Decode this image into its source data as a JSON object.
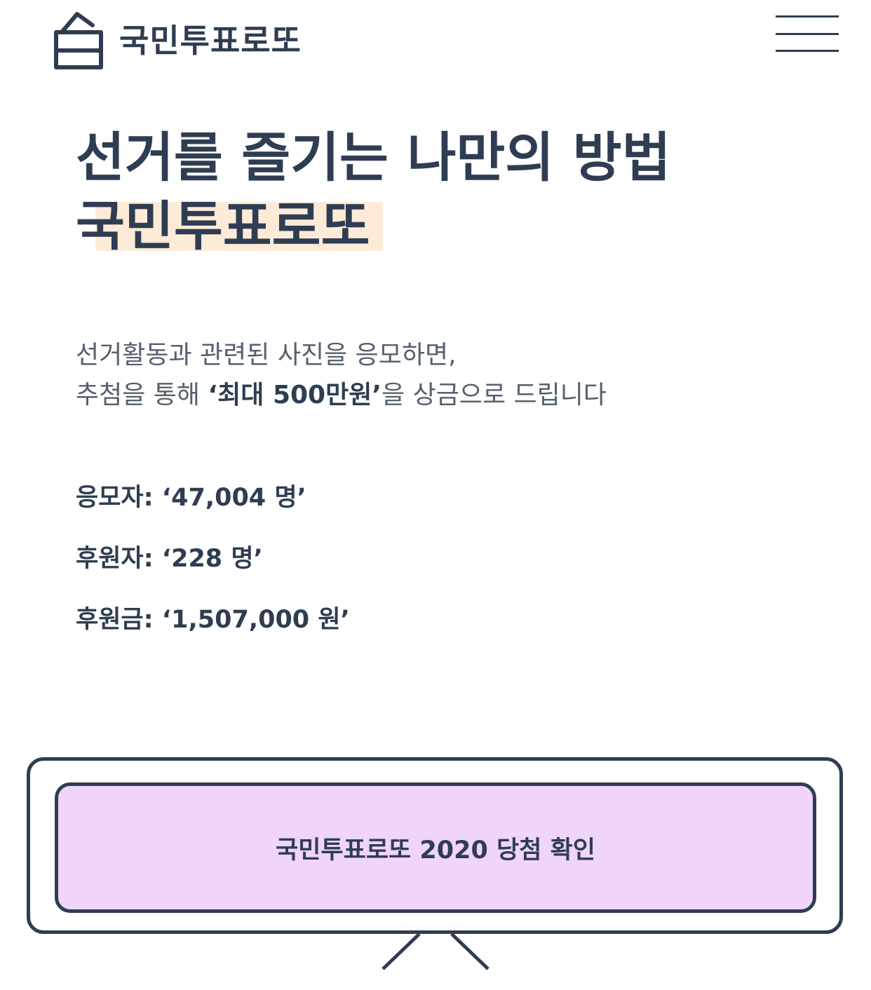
{
  "header": {
    "logo_icon": "ballot-box-icon",
    "logo_text": "국민투표로또",
    "menu_icon": "hamburger-menu-icon"
  },
  "hero": {
    "title_line1": "선거를 즐기는 나만의 방법",
    "title_line2": "국민투표로또"
  },
  "description": {
    "line1": "선거활동과 관련된 사진을 응모하면,",
    "line2_prefix": "추첨을 통해 ",
    "line2_highlight": "‘최대 500만원’",
    "line2_suffix": "을 상금으로 드립니다"
  },
  "stats": [
    {
      "label": "응모자: ",
      "value": "‘47,004 명’"
    },
    {
      "label": "후원자: ",
      "value": "‘228 명’"
    },
    {
      "label": "후원금: ",
      "value": "‘1,507,000 원’"
    }
  ],
  "cta": {
    "label": "국민투표로또 2020 당첨 확인"
  },
  "colors": {
    "text": "#2f3d52",
    "highlight_bg": "#fdebd8",
    "button_bg": "#f0d4fa",
    "body_text": "#56606e"
  }
}
